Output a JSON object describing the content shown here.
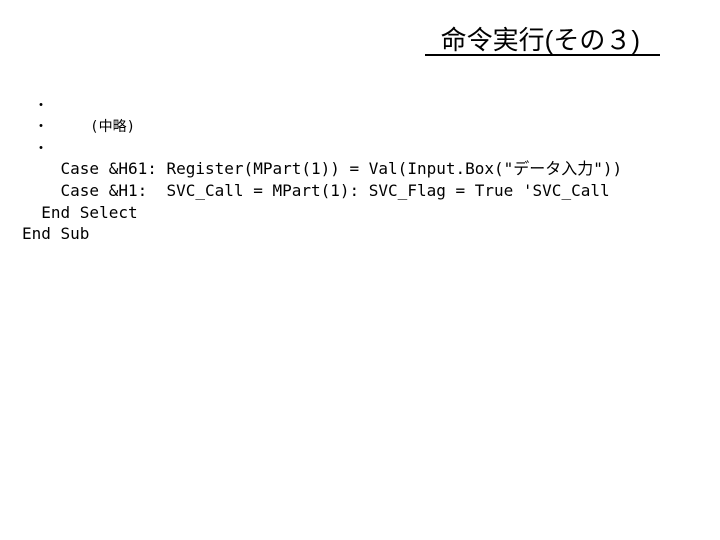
{
  "title": "命令実行(その３)",
  "code": {
    "dot1": "・",
    "dot2_prefix": "・",
    "omit": "(中略)",
    "dot3": "・",
    "line1": "    Case &H61: Register(MPart(1)) = Val(Input.Box(\"データ入力\"))",
    "line2": "    Case &H1:  SVC_Call = MPart(1): SVC_Flag = True 'SVC_Call",
    "line3": "  End Select",
    "line4": "End Sub"
  }
}
